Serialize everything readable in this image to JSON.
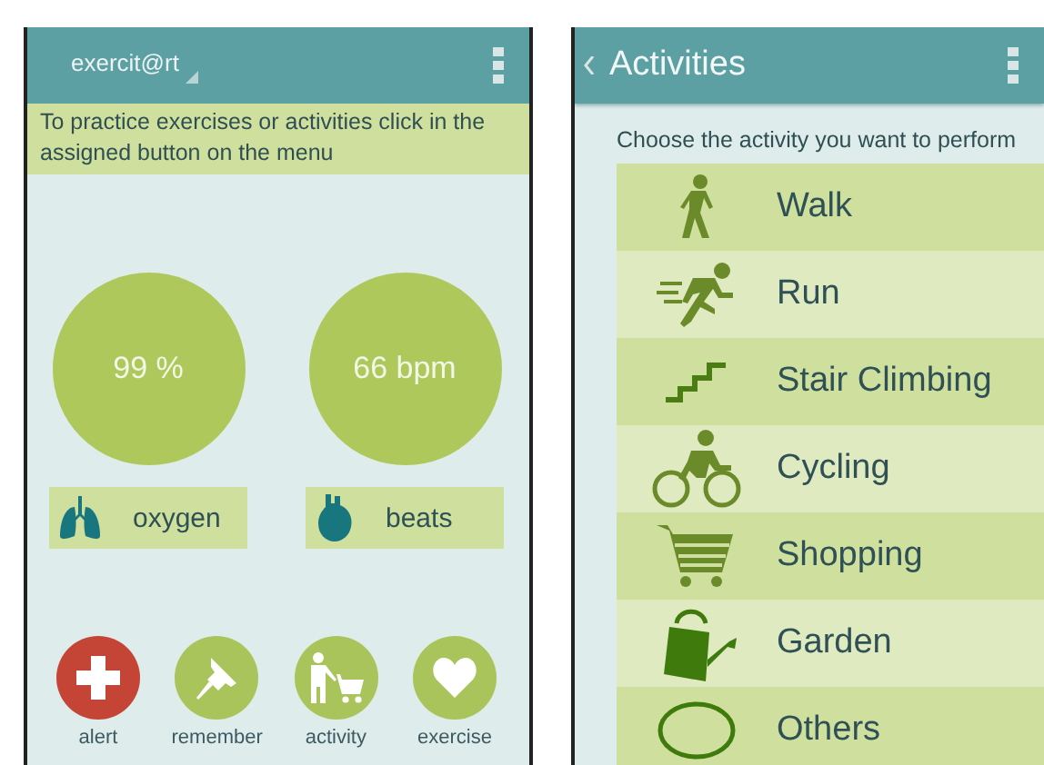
{
  "home_screen": {
    "title": "exercit@rt",
    "instruction": "To practice exercises or activities click in the assigned button on the menu",
    "readings": [
      {
        "value": "99 %",
        "label": "oxygen",
        "kind": "lungs"
      },
      {
        "value": "66 bpm",
        "label": "beats",
        "kind": "heart"
      }
    ],
    "menu_buttons": [
      {
        "label": "alert",
        "kind": "alert",
        "color": "#c44535"
      },
      {
        "label": "remember",
        "kind": "pin",
        "color": "#a9c45a"
      },
      {
        "label": "activity",
        "kind": "cart",
        "color": "#a9c45a"
      },
      {
        "label": "exercise",
        "kind": "heart",
        "color": "#a9c45a"
      }
    ]
  },
  "activities_screen": {
    "title": "Activities",
    "prompt": "Choose the activity you want to perform",
    "items": [
      {
        "label": "Walk",
        "kind": "walk"
      },
      {
        "label": "Run",
        "kind": "run"
      },
      {
        "label": "Stair Climbing",
        "kind": "stairs"
      },
      {
        "label": "Cycling",
        "kind": "cycling"
      },
      {
        "label": "Shopping",
        "kind": "cart"
      },
      {
        "label": "Garden",
        "kind": "garden"
      },
      {
        "label": "Others",
        "kind": "other"
      }
    ]
  }
}
